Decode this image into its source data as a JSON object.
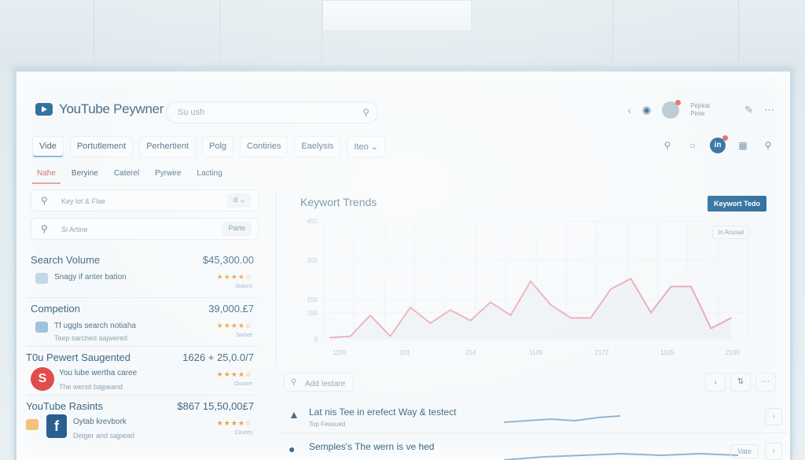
{
  "app": {
    "logo_text": "YouTube Peywner"
  },
  "search": {
    "placeholder": "Su ush"
  },
  "header": {
    "user_name": "Pejrkat",
    "user_role": "Pinte"
  },
  "nav": {
    "items": [
      "Vide",
      "Portutlement",
      "Perhertient",
      "Polg",
      "Contiries",
      "Eaelysis",
      "Iteo"
    ],
    "active_index": 0
  },
  "subnav": {
    "items": [
      "Nahe",
      "Beryine",
      "Caterel",
      "Pyrwire",
      "Lacting"
    ],
    "active_index": 0
  },
  "filters": [
    {
      "label": "Key lot & Flae",
      "right": "d"
    },
    {
      "label": "Si Artine",
      "right": "Parte"
    }
  ],
  "metrics": [
    {
      "title": "Search Volume",
      "value": "$45,300.00",
      "sub": "Snagy if anter bation",
      "sub2": "",
      "stars": "★★★★☆",
      "tag": "Stabes"
    },
    {
      "title": "Competion",
      "value": "39,000.£7",
      "sub": "Tf uggls search notiaha",
      "sub2": "Teep sarched aajwered",
      "stars": "★★★★☆",
      "tag": "Sarbet"
    },
    {
      "title": "T0u Pewert Saugented",
      "value": "1626 + 25,0.0/7",
      "sub": "You lube wertha caree",
      "sub2": "The wersit bajpeand",
      "stars": "★★★★☆",
      "tag": "Ousare",
      "badge": "S"
    },
    {
      "title": "YouTube Rasints",
      "value": "$867 15,50,00£7",
      "sub": "Oytab krevbork",
      "sub2": "Deiger and sajpead",
      "stars": "★★★★☆",
      "tag": "Coures",
      "badge": "f"
    }
  ],
  "chart": {
    "title": "Keywort Trends",
    "button": "Keywort Tedo",
    "chip": "In Anusal",
    "add_label": "Add Iestare"
  },
  "chart_data": {
    "type": "line",
    "title": "Keywort Trends",
    "x": [
      "1200",
      "201",
      "214",
      "1105",
      "2172",
      "1105",
      "2100"
    ],
    "y_ticks": [
      "0",
      "100",
      "150",
      "300",
      "450"
    ],
    "ylim": [
      0,
      450
    ],
    "series": [
      {
        "values": [
          5,
          10,
          90,
          10,
          120,
          60,
          110,
          70,
          140,
          90,
          220,
          130,
          80,
          80,
          190,
          230,
          100,
          200,
          200,
          40,
          80
        ]
      }
    ],
    "grid": true
  },
  "rows": [
    {
      "title": "Lat nis Tee in erefect Way & testect",
      "sub": "Top Feasued"
    },
    {
      "title": "Semples's The wern is ve hed",
      "sub": "",
      "chip": "Vate"
    }
  ]
}
